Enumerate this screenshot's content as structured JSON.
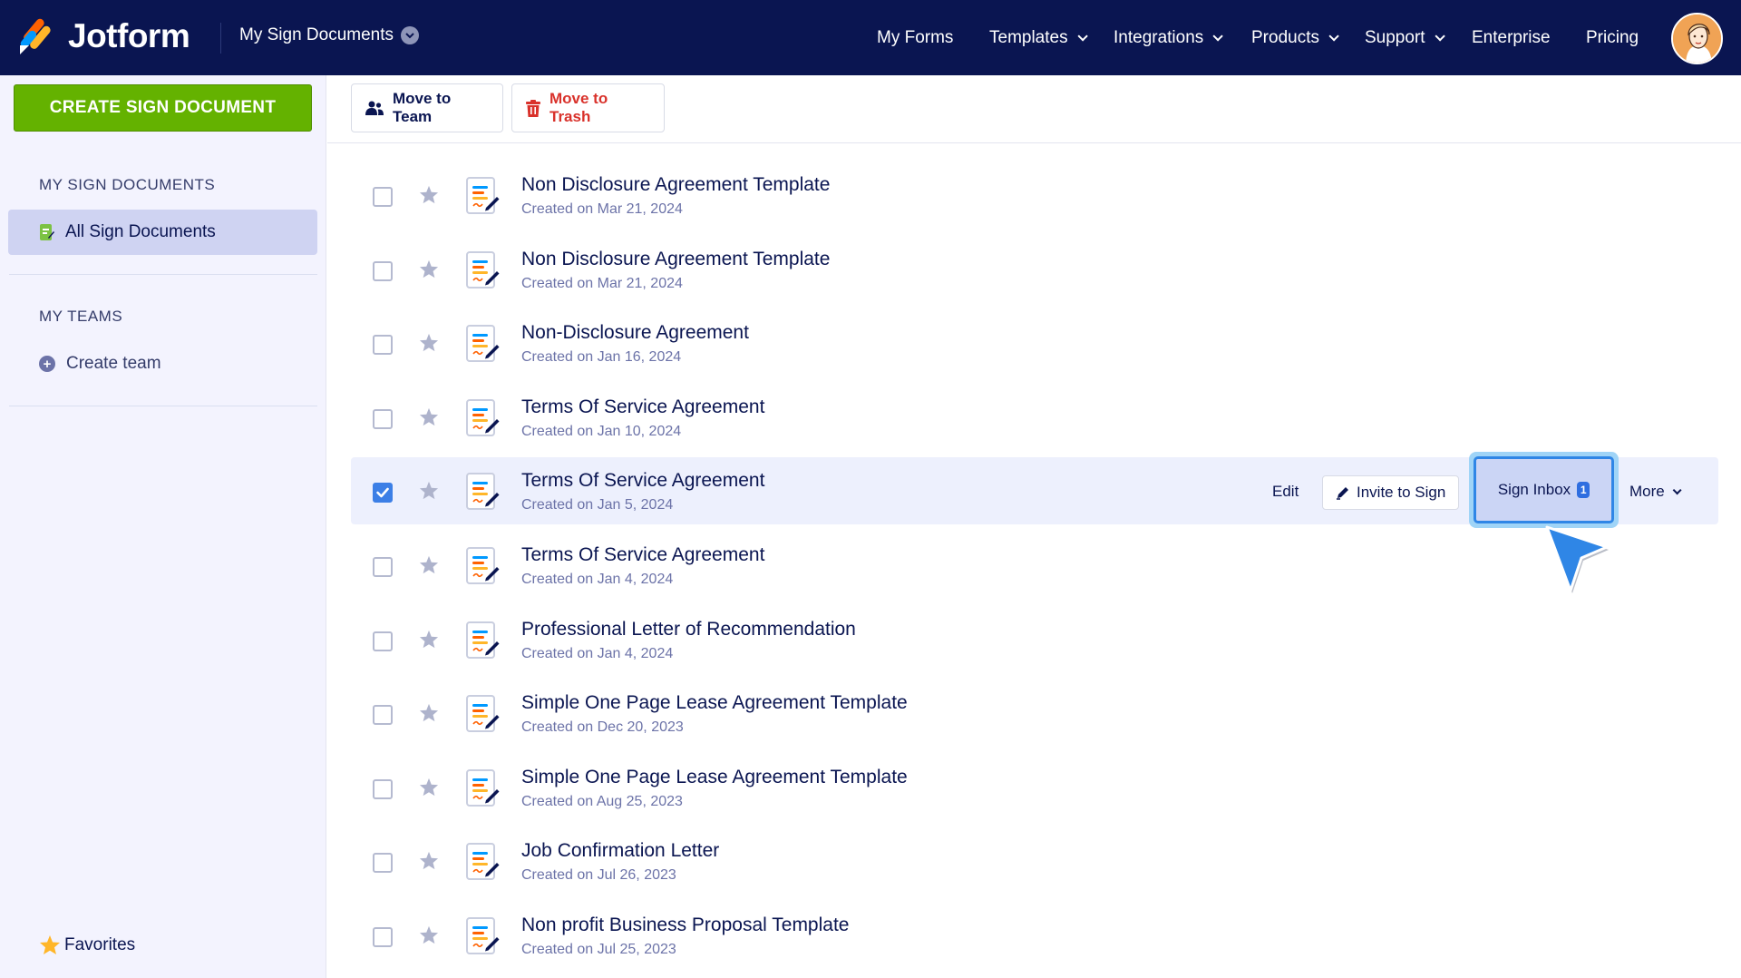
{
  "app": {
    "brand": "Jotform",
    "breadcrumb": "My Sign Documents",
    "avatar_icon": "user-avatar"
  },
  "nav": {
    "items": [
      {
        "label": "My Forms",
        "dropdown": false
      },
      {
        "label": "Templates",
        "dropdown": true
      },
      {
        "label": "Integrations",
        "dropdown": true
      },
      {
        "label": "Products",
        "dropdown": true
      },
      {
        "label": "Support",
        "dropdown": true
      },
      {
        "label": "Enterprise",
        "dropdown": false
      },
      {
        "label": "Pricing",
        "dropdown": false
      }
    ]
  },
  "sidebar": {
    "create_label": "CREATE SIGN DOCUMENT",
    "section_docs": "MY SIGN DOCUMENTS",
    "all_docs": "All Sign Documents",
    "section_teams": "MY TEAMS",
    "create_team": "Create team",
    "favorites": "Favorites"
  },
  "toolbar": {
    "move_team": "Move to Team",
    "move_trash": "Move to Trash"
  },
  "row_actions": {
    "edit": "Edit",
    "invite": "Invite to Sign",
    "inbox": "Sign Inbox",
    "inbox_count": "1",
    "more": "More"
  },
  "documents": [
    {
      "title": "Non Disclosure Agreement Template",
      "date": "Created on Mar 21, 2024",
      "selected": false
    },
    {
      "title": "Non Disclosure Agreement Template",
      "date": "Created on Mar 21, 2024",
      "selected": false
    },
    {
      "title": "Non-Disclosure Agreement",
      "date": "Created on Jan 16, 2024",
      "selected": false
    },
    {
      "title": "Terms Of Service Agreement",
      "date": "Created on Jan 10, 2024",
      "selected": false
    },
    {
      "title": "Terms Of Service Agreement",
      "date": "Created on Jan 5, 2024",
      "selected": true
    },
    {
      "title": "Terms Of Service Agreement",
      "date": "Created on Jan 4, 2024",
      "selected": false
    },
    {
      "title": "Professional Letter of Recommendation",
      "date": "Created on Jan 4, 2024",
      "selected": false
    },
    {
      "title": "Simple One Page Lease Agreement Template",
      "date": "Created on Dec 20, 2023",
      "selected": false
    },
    {
      "title": "Simple One Page Lease Agreement Template",
      "date": "Created on Aug 25, 2023",
      "selected": false
    },
    {
      "title": "Job Confirmation Letter",
      "date": "Created on Jul 26, 2023",
      "selected": false
    },
    {
      "title": "Non profit Business Proposal Template",
      "date": "Created on Jul 25, 2023",
      "selected": false
    }
  ],
  "colors": {
    "header_bg": "#0a1551",
    "create_btn": "#64b200",
    "selected_row": "#edf0fd",
    "accent_blue": "#2f86e6",
    "trash_red": "#d9322b"
  }
}
